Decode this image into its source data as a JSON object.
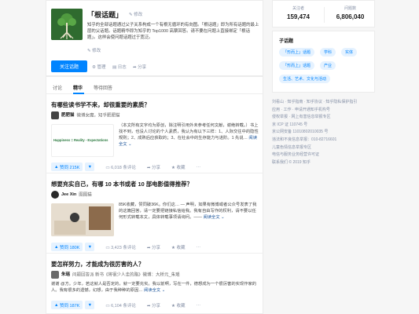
{
  "topic": {
    "title": "「根话题」",
    "edit_label": "修改",
    "description": "知乎的全部话题通过父子关系构成一个有根无循环的有向图。「根话题」即为所有话题的最上层的父话题。话题精华即为知乎的 Top1000 高票回答。请不要在问题上直接绑定「根话题」。这样会使问题话题过于宽泛。",
    "edit_label_2": "修改",
    "follow_button": "关注话题",
    "tools": {
      "manage": "管理",
      "log": "日志",
      "share": "分享"
    }
  },
  "tabs": [
    {
      "label": "讨论"
    },
    {
      "label": "精华"
    },
    {
      "label": "等待回答"
    }
  ],
  "feed": [
    {
      "title": "有哪些读书学不来，却很重要的素质？",
      "author": "肥肥猫",
      "bio": "微博女魔，知乎肥肥猫",
      "thumb_caption": "Happiness = Reality - Expectations",
      "excerpt": "（本文所有文字均为原创，除注明引用外未参考任何文献，谢绝转载。）书上找不到，也没人讨论的个人素质，我认为有以下三样：1、人际交往中的隐性规则；2、成熟后应获取的；3、在社会中的生存能力与进阶。1 先说…",
      "read_more": "阅读全文",
      "votes": "赞同 215K",
      "comments": "6,018 条评论",
      "share": "分享",
      "favorite": "收藏"
    },
    {
      "title": "想要充实自己，有哪 10 本书或者 10 部电影值得推荐？",
      "author": "Jee Xin",
      "bio": "图图猫",
      "excerpt": "85K收藏，赞同破36K。你们这… — 声明，如果有微博或者公众号发表了我的这篇回答，请一定要把链接私信给我。我有自由写作的权利，请不要以任何形式转载本文，具体转载事项请询问。——",
      "read_more": "阅读全文",
      "votes": "赞同 180K",
      "comments": "3,423 条评论",
      "share": "分享",
      "favorite": "收藏"
    },
    {
      "title": "要怎样努力，才能成为很厉害的人？",
      "author": "朱瑶",
      "bio": "问题回答派 新书《将很少人走的路》微博：大桥元_朱瑶",
      "excerpt": "谢谢 @方。少年，若这就人是否定的，就一定要充实。我以前啊，写在一件，德想成为一个很厉害的实现作家的人。我有很多的遗憾，幻想，由于我种种的原因…",
      "read_more": "阅读全文",
      "votes": "赞同 187K",
      "comments": "6,104 条评论",
      "share": "分享",
      "favorite": "收藏"
    }
  ],
  "stats": {
    "followers_label": "关注者",
    "followers": "159,474",
    "questions_label": "问题数",
    "questions": "6,806,040"
  },
  "subtopics": {
    "title": "子话题",
    "items": [
      "「形而上」话题",
      "学科",
      "实体",
      "「形而上」话题",
      "产业",
      "生活、艺术、文化与活动"
    ]
  },
  "footer_lines": [
    "刘看山 · 知乎指南 · 知乎协议 · 知乎隐私保护指引",
    "应用 · 工作 · 申请开通知乎机构号",
    "侵权举报 · 网上有害信息举报专区",
    "京 ICP 证 110745 号",
    "京公网安备 11010802010035 号",
    "违法和不良信息举报：010-82716601",
    "儿童色情信息举报专区",
    "电信与服务业务经营许可证",
    "联系我们 © 2019 知乎"
  ]
}
